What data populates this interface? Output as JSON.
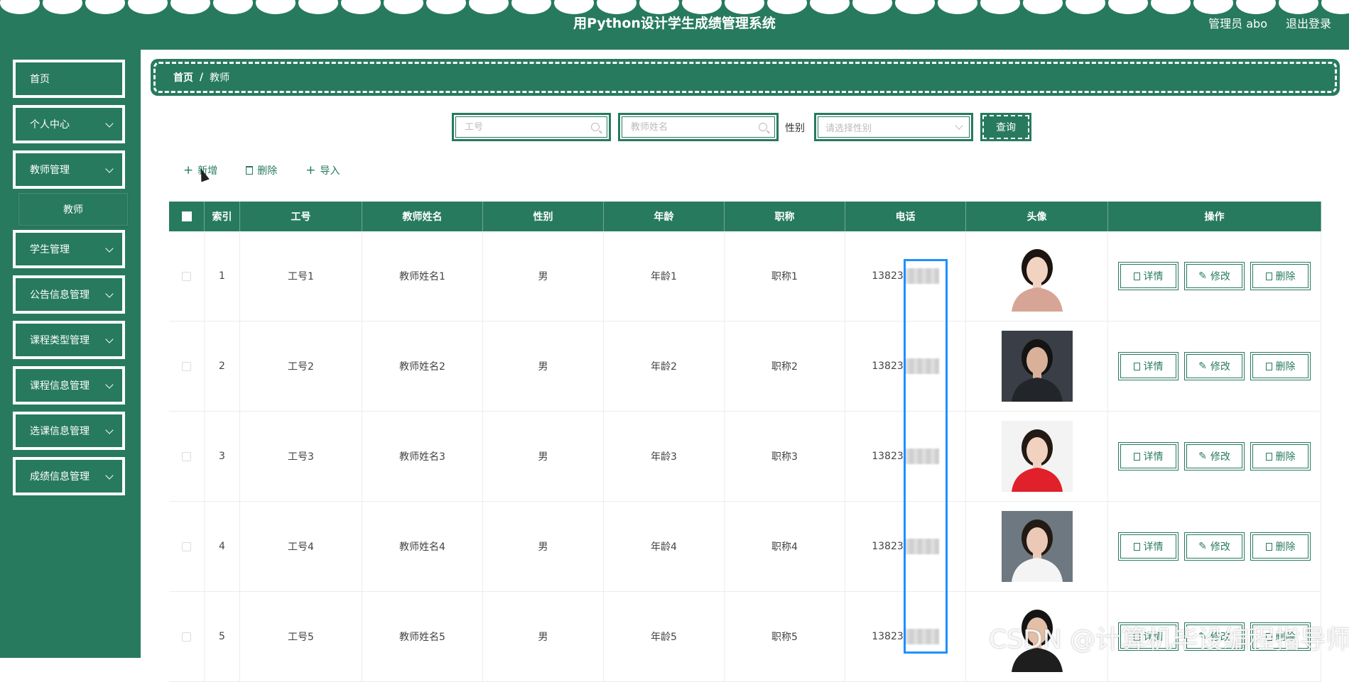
{
  "header": {
    "title": "用Python设计学生成绩管理系统",
    "user": "管理员 abo",
    "logout": "退出登录"
  },
  "sidebar": {
    "items": [
      {
        "label": "首页"
      },
      {
        "label": "个人中心"
      },
      {
        "label": "教师管理"
      },
      {
        "label": "学生管理"
      },
      {
        "label": "公告信息管理"
      },
      {
        "label": "课程类型管理"
      },
      {
        "label": "课程信息管理"
      },
      {
        "label": "选课信息管理"
      },
      {
        "label": "成绩信息管理"
      }
    ],
    "sub_item": "教师"
  },
  "breadcrumb": {
    "home": "首页",
    "sep": "/",
    "current": "教师"
  },
  "search": {
    "id_placeholder": "工号",
    "name_placeholder": "教师姓名",
    "gender_label": "性别",
    "gender_placeholder": "请选择性别",
    "query": "查询"
  },
  "toolbar": {
    "add": "新增",
    "delete": "删除",
    "import": "导入"
  },
  "table": {
    "headers": [
      "索引",
      "工号",
      "教师姓名",
      "性别",
      "年龄",
      "职称",
      "电话",
      "头像",
      "操作"
    ],
    "rows": [
      {
        "index": "1",
        "id": "工号1",
        "name": "教师姓名1",
        "sex": "男",
        "age": "年龄1",
        "title": "职称1",
        "phone": "13823"
      },
      {
        "index": "2",
        "id": "工号2",
        "name": "教师姓名2",
        "sex": "男",
        "age": "年龄2",
        "title": "职称2",
        "phone": "13823"
      },
      {
        "index": "3",
        "id": "工号3",
        "name": "教师姓名3",
        "sex": "男",
        "age": "年龄3",
        "title": "职称3",
        "phone": "13823"
      },
      {
        "index": "4",
        "id": "工号4",
        "name": "教师姓名4",
        "sex": "男",
        "age": "年龄4",
        "title": "职称4",
        "phone": "13823"
      },
      {
        "index": "5",
        "id": "工号5",
        "name": "教师姓名5",
        "sex": "男",
        "age": "年龄5",
        "title": "职称5",
        "phone": "13823"
      }
    ],
    "ops": {
      "detail": "详情",
      "edit": "修改",
      "delete": "删除"
    }
  },
  "watermark": "CSDN @计算机毕设编程指导师",
  "colors": {
    "primary": "#277a5e",
    "highlight": "#1e90ff"
  }
}
